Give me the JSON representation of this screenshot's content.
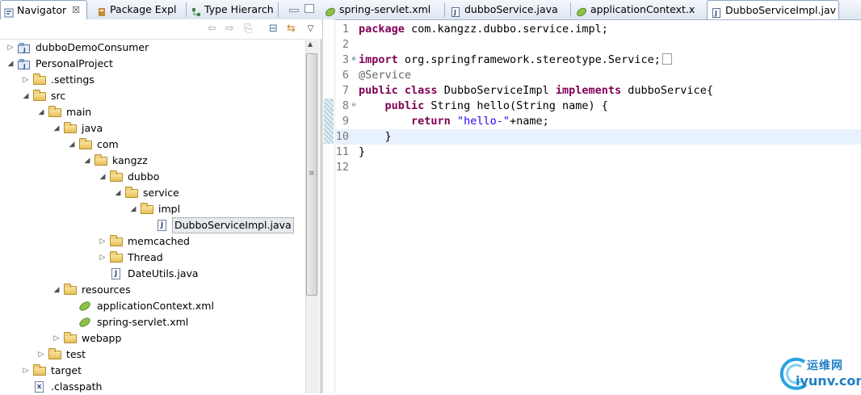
{
  "left_tabs": [
    {
      "label": "Navigator",
      "close": "☒"
    },
    {
      "label": "Package Expl"
    },
    {
      "label": "Type Hierarch"
    }
  ],
  "editor_tabs": [
    {
      "label": "spring-servlet.xml"
    },
    {
      "label": "dubboService.java"
    },
    {
      "label": "applicationContext.x"
    },
    {
      "label": "DubboServiceImpl.jav"
    }
  ],
  "tree": [
    {
      "label": "dubboDemoConsumer",
      "depth": 0,
      "expand": "▷",
      "icon": "project-icon"
    },
    {
      "label": "PersonalProject",
      "depth": 0,
      "expand": "◢",
      "icon": "project-icon"
    },
    {
      "label": ".settings",
      "depth": 1,
      "expand": "▷",
      "icon": "folder-icon"
    },
    {
      "label": "src",
      "depth": 1,
      "expand": "◢",
      "icon": "folder-icon"
    },
    {
      "label": "main",
      "depth": 2,
      "expand": "◢",
      "icon": "folder-icon"
    },
    {
      "label": "java",
      "depth": 3,
      "expand": "◢",
      "icon": "folder-icon"
    },
    {
      "label": "com",
      "depth": 4,
      "expand": "◢",
      "icon": "folder-icon"
    },
    {
      "label": "kangzz",
      "depth": 5,
      "expand": "◢",
      "icon": "folder-icon"
    },
    {
      "label": "dubbo",
      "depth": 6,
      "expand": "◢",
      "icon": "folder-icon"
    },
    {
      "label": "service",
      "depth": 7,
      "expand": "◢",
      "icon": "folder-icon"
    },
    {
      "label": "impl",
      "depth": 8,
      "expand": "◢",
      "icon": "folder-icon"
    },
    {
      "label": "DubboServiceImpl.java",
      "depth": 9,
      "expand": "",
      "icon": "java-file-icon",
      "selected": true
    },
    {
      "label": "memcached",
      "depth": 6,
      "expand": "▷",
      "icon": "folder-icon"
    },
    {
      "label": "Thread",
      "depth": 6,
      "expand": "▷",
      "icon": "folder-icon"
    },
    {
      "label": "DateUtils.java",
      "depth": 6,
      "expand": "",
      "icon": "java-file-icon"
    },
    {
      "label": "resources",
      "depth": 3,
      "expand": "◢",
      "icon": "folder-icon"
    },
    {
      "label": "applicationContext.xml",
      "depth": 4,
      "expand": "",
      "icon": "spring-xml-icon"
    },
    {
      "label": "spring-servlet.xml",
      "depth": 4,
      "expand": "",
      "icon": "spring-xml-icon"
    },
    {
      "label": "webapp",
      "depth": 3,
      "expand": "▷",
      "icon": "folder-icon"
    },
    {
      "label": "test",
      "depth": 2,
      "expand": "▷",
      "icon": "folder-icon"
    },
    {
      "label": "target",
      "depth": 1,
      "expand": "▷",
      "icon": "folder-icon"
    },
    {
      "label": ".classpath",
      "depth": 1,
      "expand": "",
      "icon": "xml-file-icon"
    }
  ],
  "code_lines": [
    {
      "n": "1",
      "parts": [
        {
          "t": "package",
          "c": "kw"
        },
        {
          "t": " com.kangzz.dubbo.service.impl;",
          "c": ""
        }
      ]
    },
    {
      "n": "2",
      "parts": []
    },
    {
      "n": "3",
      "fold": "⊕",
      "parts": [
        {
          "t": "import",
          "c": "kw"
        },
        {
          "t": " org.springframework.stereotype.Service;",
          "c": ""
        }
      ],
      "ellipsis": true
    },
    {
      "n": "6",
      "parts": [
        {
          "t": "@Service",
          "c": "ann"
        }
      ]
    },
    {
      "n": "7",
      "parts": [
        {
          "t": "public",
          "c": "kw"
        },
        {
          "t": " ",
          "c": ""
        },
        {
          "t": "class",
          "c": "kw"
        },
        {
          "t": " DubboServiceImpl ",
          "c": ""
        },
        {
          "t": "implements",
          "c": "kw"
        },
        {
          "t": " dubboService{",
          "c": ""
        }
      ]
    },
    {
      "n": "8",
      "fold": "⊖",
      "parts": [
        {
          "t": "    ",
          "c": ""
        },
        {
          "t": "public",
          "c": "kw"
        },
        {
          "t": " String hello(String name) {",
          "c": ""
        }
      ]
    },
    {
      "n": "9",
      "parts": [
        {
          "t": "        ",
          "c": ""
        },
        {
          "t": "return",
          "c": "kw"
        },
        {
          "t": " ",
          "c": ""
        },
        {
          "t": "\"hello-\"",
          "c": "str"
        },
        {
          "t": "+name;",
          "c": ""
        }
      ]
    },
    {
      "n": "10",
      "parts": [
        {
          "t": "    }",
          "c": ""
        }
      ],
      "current": true
    },
    {
      "n": "11",
      "parts": [
        {
          "t": "}",
          "c": ""
        }
      ]
    },
    {
      "n": "12",
      "parts": []
    }
  ],
  "watermark": {
    "top": "运维网",
    "bottom": "iyunv.com"
  },
  "colors": {
    "keyword": "#7f0055",
    "string": "#2a00ff",
    "annotation": "#646464",
    "current_line": "#e8f2fe"
  }
}
